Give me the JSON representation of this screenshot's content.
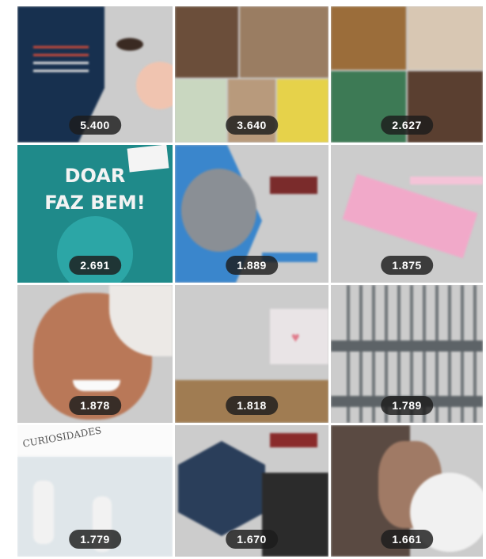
{
  "gallery": {
    "tiles": [
      {
        "count": "5.400"
      },
      {
        "count": "3.640"
      },
      {
        "count": "2.627"
      },
      {
        "count": "2.691",
        "title": "DOAR\nFAZ BEM!"
      },
      {
        "count": "1.889"
      },
      {
        "count": "1.875"
      },
      {
        "count": "1.878"
      },
      {
        "count": "1.818"
      },
      {
        "count": "1.789"
      },
      {
        "count": "1.779",
        "heading": "CURIOSIDADES"
      },
      {
        "count": "1.670"
      },
      {
        "count": "1.661"
      }
    ]
  },
  "colors": {
    "badge_bg": "#1c1c1c",
    "teal": "#1f8a8a",
    "blue": "#3a86cc",
    "navy": "#17304f"
  }
}
